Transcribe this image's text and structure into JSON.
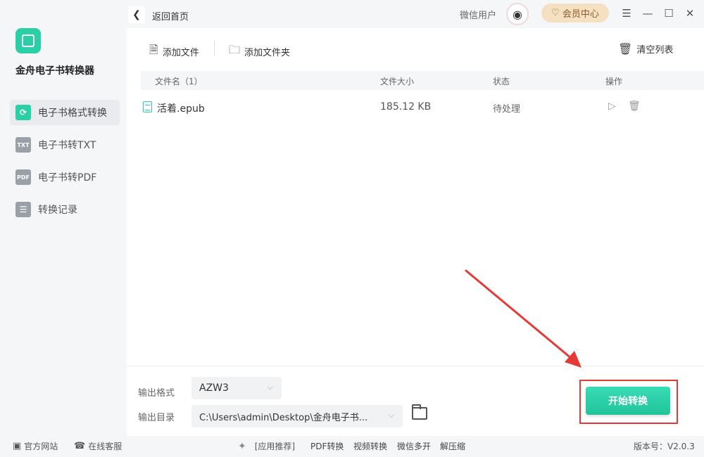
{
  "app": {
    "name": "金舟电子书转换器"
  },
  "sidebar": {
    "items": [
      {
        "label": "电子书格式转换",
        "icon": "refresh-icon",
        "badge": "⟳"
      },
      {
        "label": "电子书转TXT",
        "icon": "txt-icon",
        "badge": "TXT"
      },
      {
        "label": "电子书转PDF",
        "icon": "pdf-icon",
        "badge": "PDF"
      },
      {
        "label": "转换记录",
        "icon": "list-icon",
        "badge": "☰"
      }
    ]
  },
  "header": {
    "back_label": "返回首页",
    "user_name": "微信用户",
    "vip_label": "会员中心"
  },
  "toolbar": {
    "add_file": "添加文件",
    "add_folder": "添加文件夹",
    "clear_list": "清空列表"
  },
  "table": {
    "columns": [
      "文件名（1）",
      "文件大小",
      "状态",
      "操作"
    ],
    "rows": [
      {
        "name": "活着.epub",
        "size": "185.12 KB",
        "status": "待处理"
      }
    ]
  },
  "output": {
    "format_label": "输出格式",
    "format_value": "AZW3",
    "dir_label": "输出目录",
    "dir_value": "C:\\Users\\admin\\Desktop\\金舟电子书..."
  },
  "start_label": "开始转换",
  "footer": {
    "website": "官方网站",
    "service": "在线客服",
    "recommend": "[应用推荐]",
    "links": [
      "PDF转换",
      "视频转换",
      "微信多开",
      "解压缩"
    ],
    "version": "版本号：V2.0.3"
  },
  "colors": {
    "accent": "#2bcfa6",
    "highlight": "#e53935"
  }
}
